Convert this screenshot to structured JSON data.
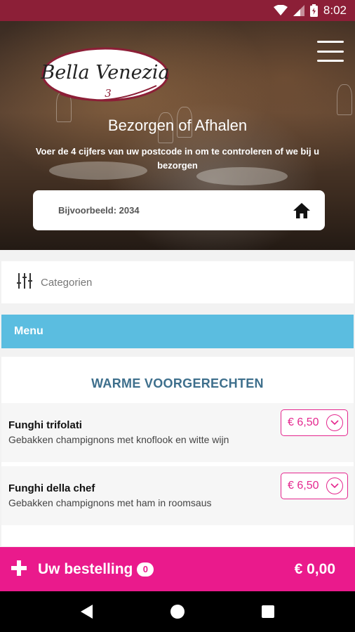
{
  "status_bar": {
    "time": "8:02",
    "icons": [
      "wifi-icon",
      "signal-icon",
      "battery-icon"
    ]
  },
  "header": {
    "logo_text": "Bella Venezia",
    "logo_number": "3",
    "title": "Bezorgen of Afhalen",
    "subtitle": "Voer de 4 cijfers van uw postcode in om te controleren of we bij u bezorgen",
    "postcode": {
      "placeholder": "Bijvoorbeeld: 2034",
      "value": ""
    },
    "home_icon": "home-icon",
    "menu_icon": "hamburger-icon"
  },
  "categories": {
    "label": "Categorien",
    "icon": "sliders-icon"
  },
  "menu": {
    "header": "Menu",
    "section_title": "WARME VOORGERECHTEN",
    "items": [
      {
        "name": "Funghi trifolati",
        "description": "Gebakken champignons met knoflook en witte wijn",
        "price": "€ 6,50"
      },
      {
        "name": "Funghi della chef",
        "description": "Gebakken champignons met ham in roomsaus",
        "price": "€ 6,50"
      }
    ]
  },
  "order_bar": {
    "label": "Uw bestelling",
    "count": "0",
    "total": "€ 0,00"
  },
  "colors": {
    "status_bar": "#8c1f37",
    "accent": "#ea1a8c",
    "menu_bar": "#5bbde0",
    "section_title": "#3e6f8c"
  },
  "nav_bar": {
    "icons": [
      "back-icon",
      "home-circle-icon",
      "recents-icon"
    ]
  }
}
